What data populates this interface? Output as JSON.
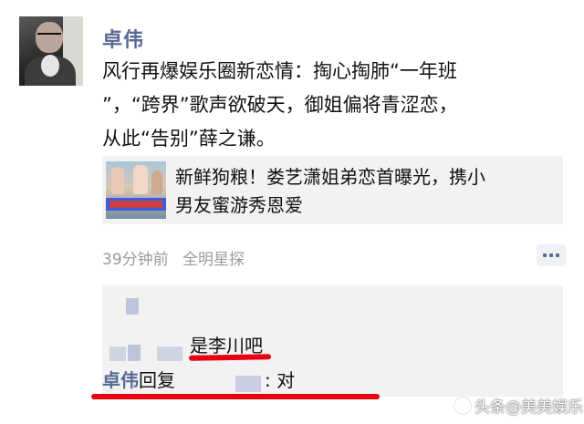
{
  "post": {
    "author": "卓伟",
    "text_lines": [
      "风行再爆娱乐圈新恋情：掏心掏肺“一年班",
      "”，“跨界”歌声欲破天，御姐偏将青涩恋，",
      "从此“告别”薛之谦。"
    ]
  },
  "link_card": {
    "title_lines": [
      "新鲜狗粮！娄艺潇姐弟恋首曝光，携小",
      "男友蜜游秀恩爱"
    ]
  },
  "meta": {
    "time": "39分钟前",
    "source": "全明星探"
  },
  "comments": {
    "reply_text": "是李川吧",
    "reply_name": "卓伟",
    "reply_verb": "回复",
    "reply_tail": ": 对"
  },
  "watermark": {
    "text": "头条@美美娱乐"
  },
  "colors": {
    "link_blue": "#576b95",
    "highlight_red": "#e60012"
  }
}
